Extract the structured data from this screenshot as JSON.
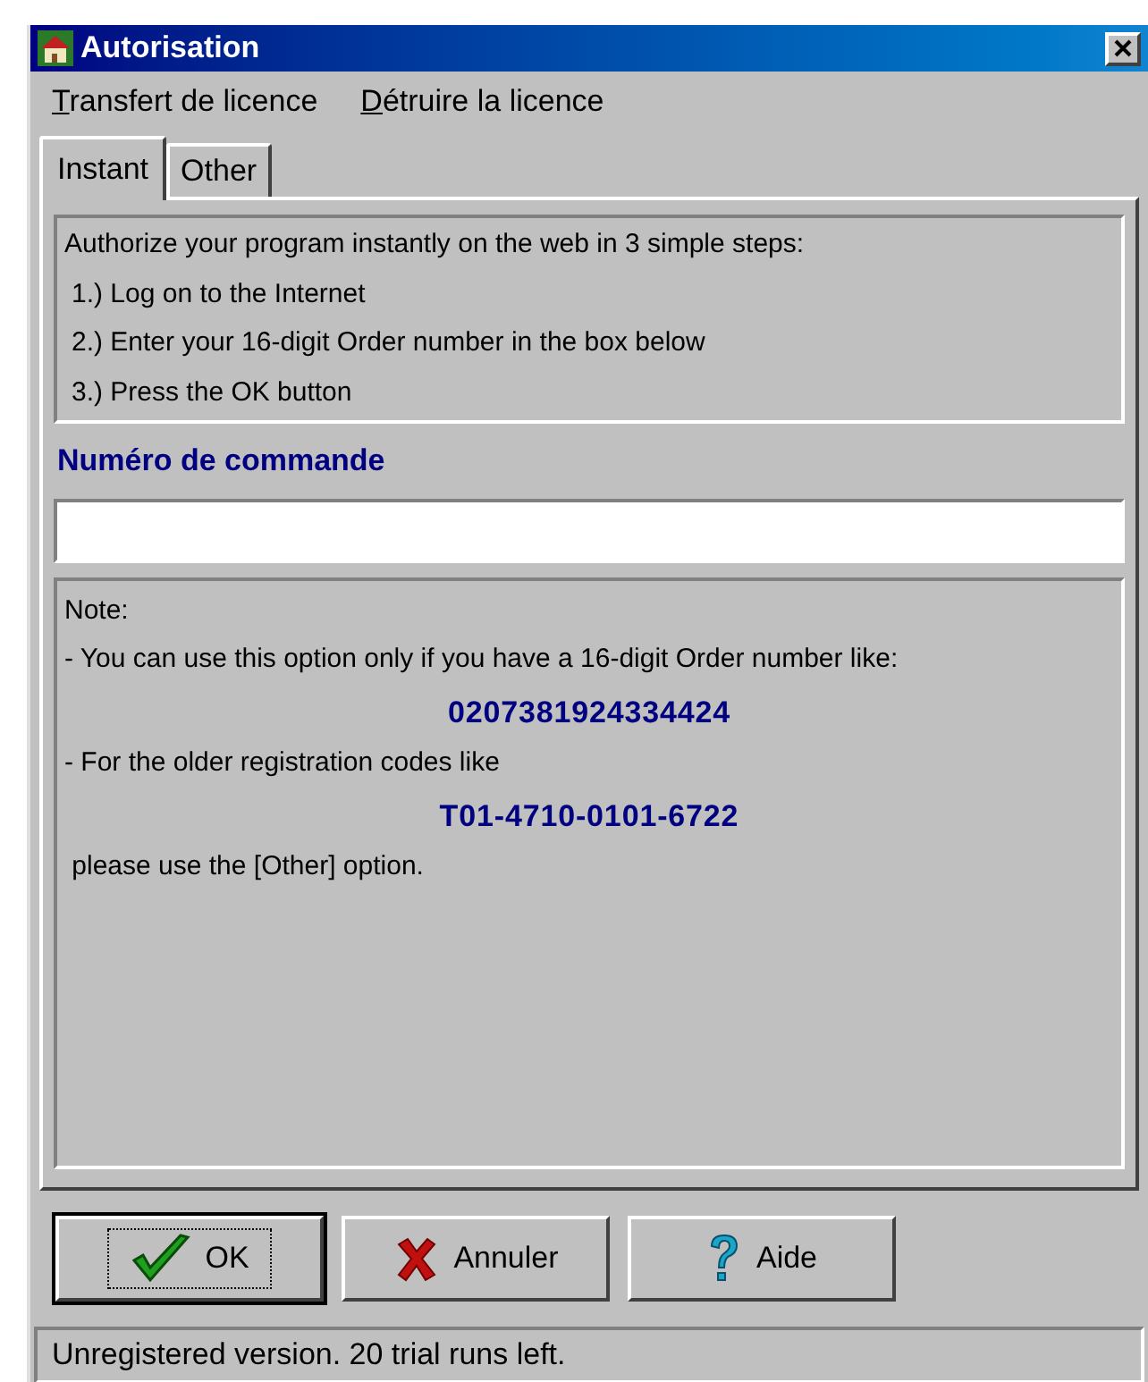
{
  "window": {
    "title": "Autorisation"
  },
  "menu": [
    {
      "label": "Transfert de licence"
    },
    {
      "label": "Détruire la licence"
    }
  ],
  "tabs": [
    {
      "label": "Instant",
      "selected": true
    },
    {
      "label": "Other",
      "selected": false
    }
  ],
  "instructions": {
    "intro": "Authorize your program instantly on the web in 3 simple steps:",
    "steps": [
      "1.) Log on to the Internet",
      "2.) Enter your 16-digit Order number in the box below",
      "3.) Press the OK button"
    ]
  },
  "order_field": {
    "label": "Numéro de commande"
  },
  "note": {
    "title": "Note:",
    "line_1": "- You can use this option only if you have a 16-digit Order number like:",
    "example_1": "0207381924334424",
    "line_2": "- For the older registration codes like",
    "example_2": "T01-4710-0101-6722",
    "line_3": " please use the [Other] option."
  },
  "buttons": [
    {
      "kind": "ok",
      "label": "OK",
      "focused": true
    },
    {
      "kind": "cancel",
      "label": "Annuler",
      "focused": false
    },
    {
      "kind": "help",
      "label": "Aide",
      "focused": false
    }
  ],
  "status_bar": "Unregistered version. 20 trial runs left."
}
